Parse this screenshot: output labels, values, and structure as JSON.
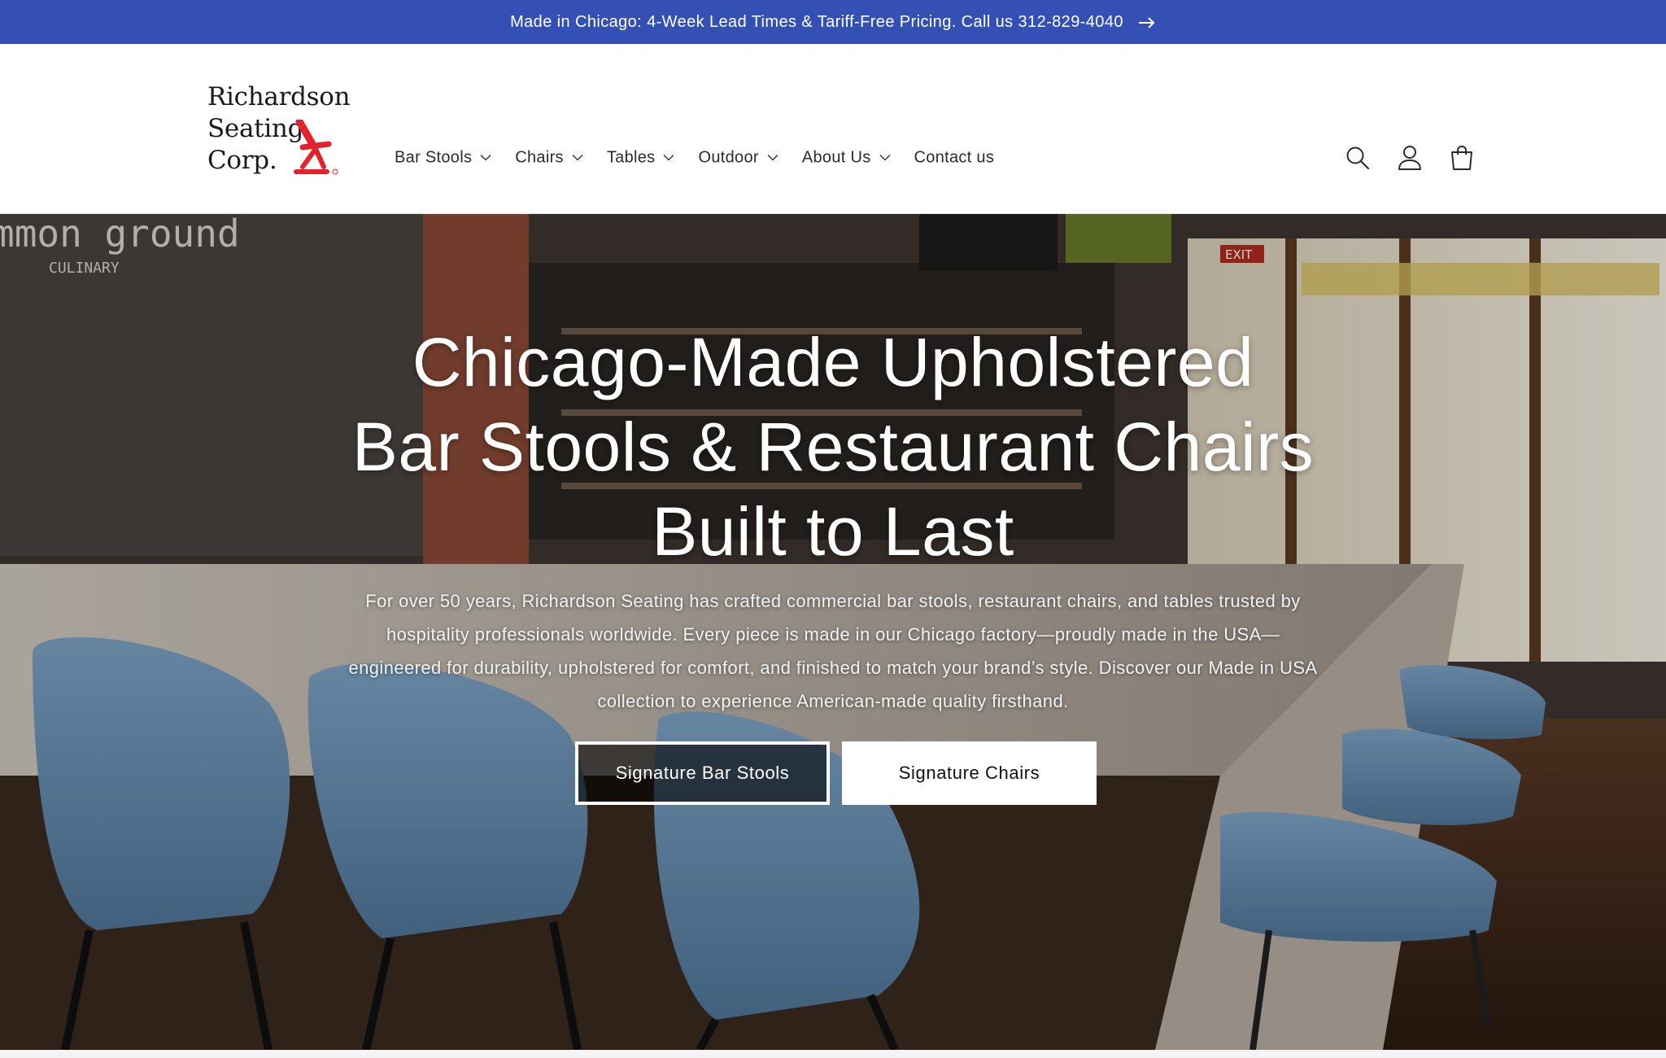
{
  "announcement": {
    "text": "Made in Chicago: 4-Week Lead Times & Tariff-Free Pricing. Call us 312-829-4040",
    "icon": "arrow-right-icon",
    "background": "#3450b4"
  },
  "logo": {
    "line1": "Richardson",
    "line2": "Seating",
    "line3": "Corp.",
    "mark_color": "#e5222c"
  },
  "nav": {
    "items": [
      {
        "label": "Bar Stools",
        "has_dropdown": true
      },
      {
        "label": "Chairs",
        "has_dropdown": true
      },
      {
        "label": "Tables",
        "has_dropdown": true
      },
      {
        "label": "Outdoor",
        "has_dropdown": true
      },
      {
        "label": "About Us",
        "has_dropdown": true
      },
      {
        "label": "Contact us",
        "has_dropdown": false
      }
    ]
  },
  "header_icons": [
    "search-icon",
    "account-icon",
    "cart-icon"
  ],
  "hero": {
    "title_line1": "Chicago-Made Upholstered",
    "title_line2": "Bar Stools & Restaurant Chairs",
    "title_line3": "Built to Last",
    "body": "For over 50 years, Richardson Seating has crafted commercial bar stools, restaurant chairs, and tables trusted by hospitality professionals worldwide. Every piece is made in our Chicago factory—proudly made in the USA—engineered for durability, upholstered for comfort, and finished to match your brand’s style. Discover our Made in USA collection to experience American-made quality firsthand.",
    "buttons": {
      "primary": "Signature Bar Stools",
      "secondary": "Signature Chairs"
    },
    "image_signs": {
      "wall_sign": "mmon ground",
      "wall_sub": "CULINARY",
      "exit": "EXIT"
    },
    "stool_color": "#6b93b8"
  }
}
